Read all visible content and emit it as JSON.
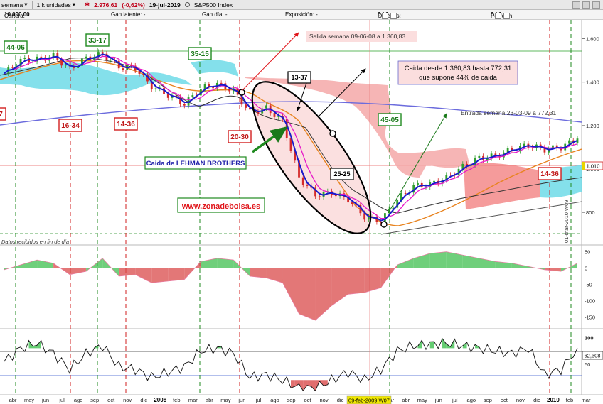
{
  "toolbar": {
    "period": "semana",
    "units": "1 k unidades",
    "price": "2.976,61",
    "change": "(-0,62%)",
    "date": "19-jul-2019",
    "instrument": "S&P500 Index"
  },
  "infobar": {
    "cartera_label": "Cartera:",
    "cartera_value": "10.000,00",
    "latente": "Gan latente:  -",
    "gan_dia": "Gan día:  -",
    "exposicion": "Exposición:  -",
    "ordenes_label": "Órdenes:",
    "ordenes_value": "0",
    "ordenes_value2": "0",
    "posicion_label": "Posición:",
    "posicion_value": "0",
    "posicion_value2": "0"
  },
  "annotations": {
    "salida": "Salida semana 09-06-08 a 1.360,83",
    "caida_line1": "Caida desde 1.360,83 hasta 772,31",
    "caida_line2": "que supone 44% de caida",
    "entrada": "Entrada semana 23-03-09 a 772,31",
    "lehman": "Caida de LEHMAN BROTHERS",
    "web": "www.zonadebolsa.es",
    "datos": "Datos recibidos en fin de día",
    "cursor_date": "09-feb-2009 W07",
    "vertical_date": "01-mar-2010 W09",
    "price_tag": "1.010",
    "rsi_tag": "62,308"
  },
  "badges": [
    {
      "text": "44-06",
      "color": "green"
    },
    {
      "text": "33-17",
      "color": "green"
    },
    {
      "text": "35-15",
      "color": "green"
    },
    {
      "text": "13-37",
      "color": "black"
    },
    {
      "text": "25-25",
      "color": "black"
    },
    {
      "text": "45-05",
      "color": "green"
    },
    {
      "text": "16-34",
      "color": "red"
    },
    {
      "text": "14-36",
      "color": "red"
    },
    {
      "text": "20-30",
      "color": "red"
    },
    {
      "text": "14-36",
      "color": "red"
    },
    {
      "text": "7",
      "color": "red"
    }
  ],
  "colors": {
    "up": "#2f9e2f",
    "down": "#d42a2a",
    "kumo_up": "#5ed6e6",
    "kumo_down": "#f29a9a",
    "ma_fast": "#1a1acc",
    "ma_mid": "#e619c8",
    "ma_slow": "#e8831f",
    "ma_long": "#6666dd"
  },
  "chart_data": [
    {
      "type": "line",
      "panel": "price",
      "instrument": "S&P500 Index",
      "x": [
        "2007-04",
        "2007-05",
        "2007-06",
        "2007-07",
        "2007-08",
        "2007-09",
        "2007-10",
        "2007-11",
        "2007-12",
        "2008-01",
        "2008-02",
        "2008-03",
        "2008-04",
        "2008-05",
        "2008-06",
        "2008-07",
        "2008-08",
        "2008-09",
        "2008-10",
        "2008-11",
        "2008-12",
        "2009-01",
        "2009-02",
        "2009-03",
        "2009-04",
        "2009-05",
        "2009-06",
        "2009-07",
        "2009-08",
        "2009-09",
        "2009-10",
        "2009-11",
        "2009-12",
        "2010-01",
        "2010-02",
        "2010-03"
      ],
      "series": [
        {
          "values": [
            1440,
            1500,
            1505,
            1520,
            1460,
            1510,
            1530,
            1470,
            1465,
            1380,
            1340,
            1300,
            1370,
            1390,
            1360,
            1260,
            1280,
            1220,
            960,
            880,
            890,
            860,
            780,
            760,
            860,
            920,
            930,
            960,
            1010,
            1050,
            1060,
            1090,
            1110,
            1090,
            1100,
            1140
          ]
        }
      ],
      "x_ticks": [
        "abr",
        "may",
        "jun",
        "jul",
        "ago",
        "sep",
        "oct",
        "nov",
        "dic",
        "2008",
        "feb",
        "mar",
        "abr",
        "may",
        "jun",
        "jul",
        "ago",
        "sep",
        "oct",
        "nov",
        "dic",
        "2009",
        "feb",
        "mar",
        "abr",
        "may",
        "jun",
        "jul",
        "ago",
        "sep",
        "oct",
        "nov",
        "dic",
        "2010",
        "feb",
        "mar"
      ],
      "y_ticks": [
        800,
        1000,
        1200,
        1400,
        1600
      ],
      "ylim": [
        660,
        1680
      ]
    },
    {
      "type": "area",
      "panel": "momentum",
      "series": [
        {
          "values": [
            -5,
            10,
            25,
            15,
            -20,
            -10,
            30,
            -25,
            -20,
            -45,
            -40,
            -35,
            20,
            30,
            25,
            -25,
            -30,
            -45,
            -140,
            -160,
            -115,
            -80,
            -75,
            -60,
            10,
            30,
            45,
            50,
            40,
            30,
            20,
            15,
            5,
            -5,
            -10,
            15
          ]
        }
      ],
      "y_ticks": [
        50,
        0,
        -50,
        -100,
        -150
      ],
      "ylim": [
        -175,
        60
      ]
    },
    {
      "type": "line",
      "panel": "oscillator",
      "series": [
        {
          "values": [
            55,
            80,
            90,
            70,
            40,
            70,
            85,
            45,
            40,
            25,
            35,
            45,
            75,
            80,
            70,
            25,
            30,
            20,
            5,
            5,
            20,
            35,
            20,
            40,
            75,
            85,
            88,
            90,
            85,
            80,
            75,
            70,
            80,
            30,
            40,
            80
          ]
        }
      ],
      "y_ticks": [
        100,
        50
      ],
      "ylim": [
        -5,
        110
      ]
    }
  ]
}
